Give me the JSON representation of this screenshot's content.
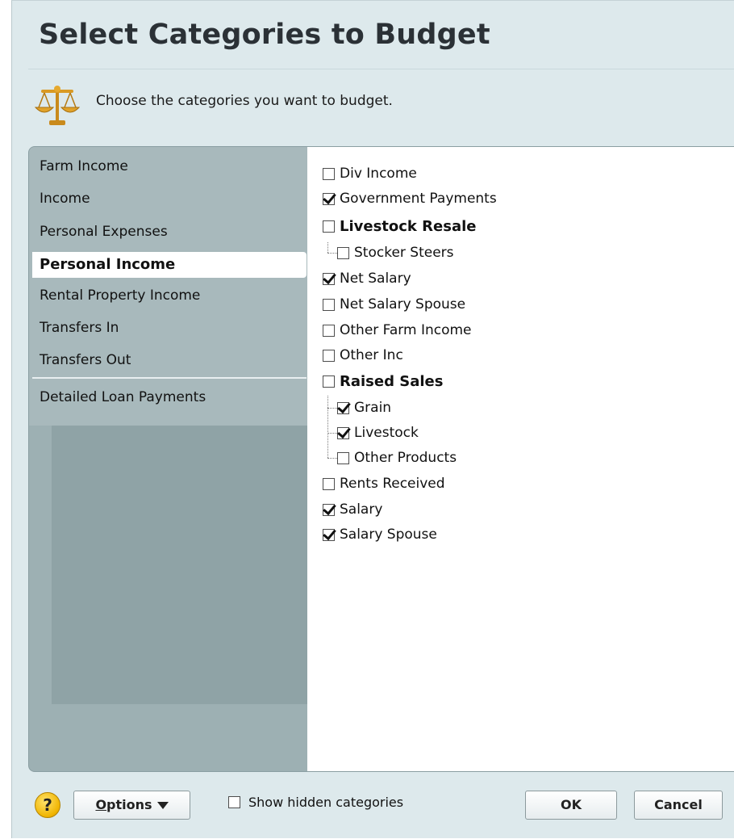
{
  "dialog": {
    "title": "Select Categories to Budget",
    "instruction": "Choose the categories you want to budget."
  },
  "category_groups": [
    {
      "label": "Farm Income",
      "selected": false
    },
    {
      "label": "Income",
      "selected": false
    },
    {
      "label": "Personal Expenses",
      "selected": false
    },
    {
      "label": "Personal Income",
      "selected": true
    },
    {
      "label": "Rental Property Income",
      "selected": false
    },
    {
      "label": "Transfers In",
      "selected": false
    },
    {
      "label": "Transfers Out",
      "selected": false
    },
    {
      "label": "Detailed Loan Payments",
      "selected": false
    }
  ],
  "categories": [
    {
      "label": "Div Income",
      "checked": false
    },
    {
      "label": "Government Payments",
      "checked": true
    },
    {
      "label": "Livestock Resale",
      "checked": false,
      "parent": true
    },
    {
      "label": "Stocker Steers",
      "checked": false
    },
    {
      "label": "Net Salary",
      "checked": true
    },
    {
      "label": "Net Salary Spouse",
      "checked": false
    },
    {
      "label": "Other Farm Income",
      "checked": false
    },
    {
      "label": "Other Inc",
      "checked": false
    },
    {
      "label": "Raised Sales",
      "checked": false,
      "parent": true
    },
    {
      "label": "Grain",
      "checked": true
    },
    {
      "label": "Livestock",
      "checked": true
    },
    {
      "label": "Other Products",
      "checked": false
    },
    {
      "label": "Rents Received",
      "checked": false
    },
    {
      "label": "Salary",
      "checked": true
    },
    {
      "label": "Salary Spouse",
      "checked": true
    }
  ],
  "footer": {
    "help_label": "?",
    "options_label_first": "O",
    "options_label_rest": "ptions",
    "show_hidden_label": "Show hidden categories",
    "show_hidden_checked": false,
    "ok_label": "OK",
    "cancel_label": "Cancel"
  },
  "colors": {
    "dialog_bg": "#dde9ec",
    "left_pane_bg": "#9db0b3",
    "help_icon": "#f0b400"
  },
  "icons": {
    "header": "scale-icon",
    "help": "question-mark-icon",
    "options_dropdown": "caret-down-icon"
  }
}
